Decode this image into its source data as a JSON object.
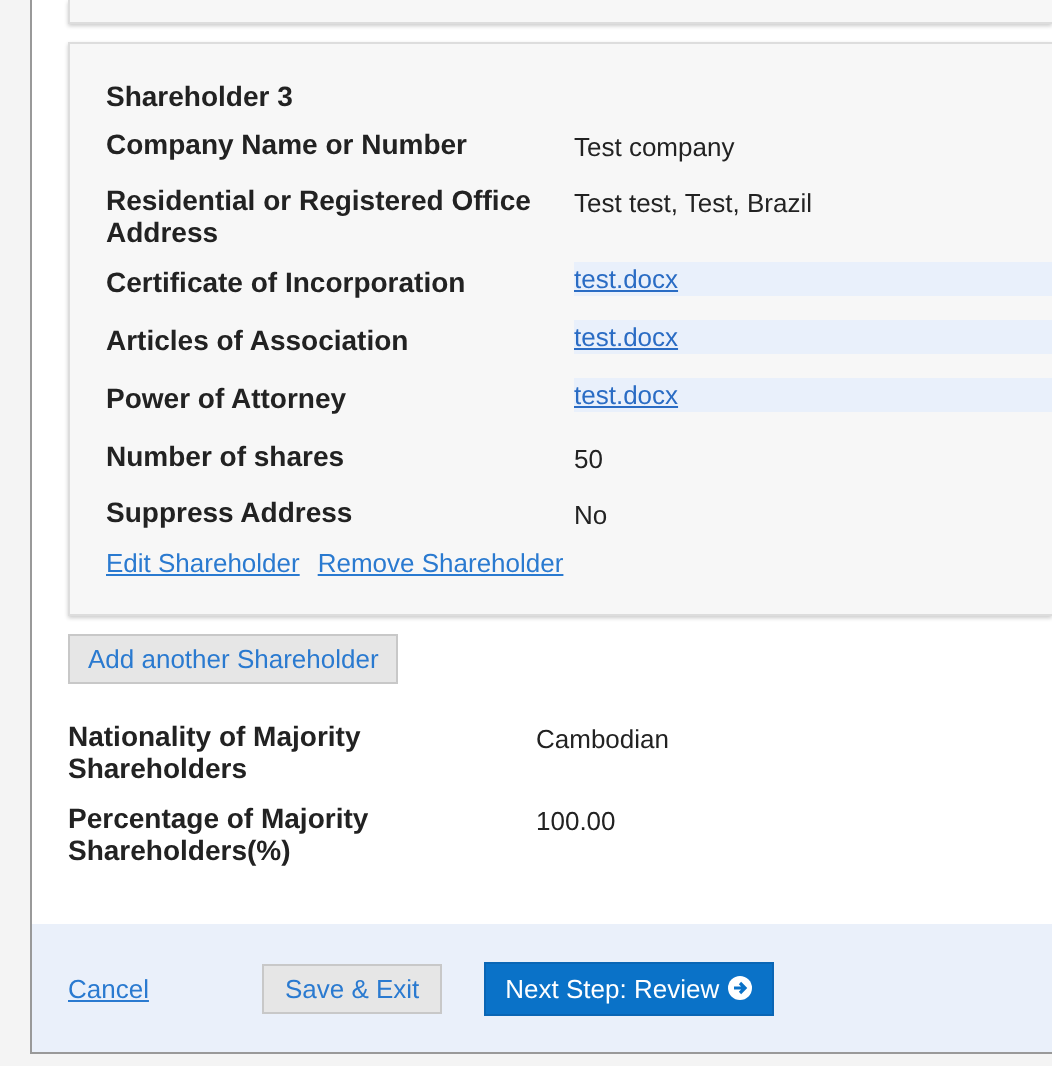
{
  "shareholder": {
    "title": "Shareholder 3",
    "fields": [
      {
        "kind": "text",
        "label": "Company Name or Number",
        "value": "Test company"
      },
      {
        "kind": "text",
        "label": "Residential or Registered Office Address",
        "value": "Test test, Test, Brazil"
      },
      {
        "kind": "file",
        "label": "Certificate of Incorporation",
        "value": "test.docx"
      },
      {
        "kind": "file",
        "label": "Articles of Association",
        "value": "test.docx"
      },
      {
        "kind": "file",
        "label": "Power of Attorney",
        "value": "test.docx"
      },
      {
        "kind": "text",
        "label": "Number of shares",
        "value": "50"
      },
      {
        "kind": "text",
        "label": "Suppress Address",
        "value": "No"
      }
    ],
    "actions": [
      "Edit Shareholder",
      "Remove Shareholder"
    ]
  },
  "add_button": "Add another Shareholder",
  "summary": [
    {
      "label": "Nationality of Majority Shareholders",
      "value": "Cambodian"
    },
    {
      "label": "Percentage of Majority Shareholders(%)",
      "value": "100.00"
    }
  ],
  "footer": {
    "cancel": "Cancel",
    "save": "Save & Exit",
    "next": "Next Step: Review"
  }
}
